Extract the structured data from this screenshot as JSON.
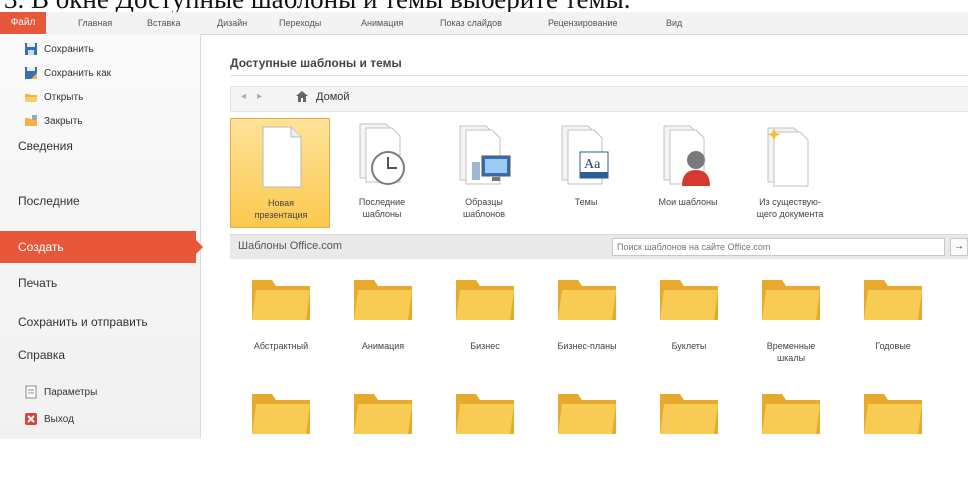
{
  "caption": "3. В окне Доступные шаблоны и темы выберите темы.",
  "ribbon": {
    "file_tab": "Файл",
    "tabs": [
      "Главная",
      "Вставка",
      "Дизайн",
      "Переходы",
      "Анимация",
      "Показ слайдов",
      "Рецензирование",
      "Вид"
    ]
  },
  "sidebar": {
    "save": "Сохранить",
    "save_as": "Сохранить как",
    "open": "Открыть",
    "close": "Закрыть",
    "info": "Сведения",
    "recent": "Последние",
    "new": "Создать",
    "print": "Печать",
    "save_send": "Сохранить и отправить",
    "help": "Справка",
    "options": "Параметры",
    "exit": "Выход"
  },
  "main": {
    "heading": "Доступные шаблоны и темы",
    "nav_back": "◂",
    "nav_forward": "▸",
    "home_label": "Домой",
    "tiles": [
      "Новая\nпрезентация",
      "Последние\nшаблоны",
      "Образцы\nшаблонов",
      "Темы",
      "Мои шаблоны",
      "Из существую-\nщего документа"
    ],
    "office_section": "Шаблоны Office.com",
    "search_placeholder": "Поиск шаблонов на сайте Office.com",
    "search_button": "→",
    "folders": [
      "Абстрактный",
      "Анимация",
      "Бизнес",
      "Бизнес-планы",
      "Буклеты",
      "Временные\nшкалы",
      "Годовые"
    ]
  },
  "colors": {
    "accent": "#e8573a",
    "selected_tile": "#fbc94e",
    "folder": "#f5c143"
  }
}
